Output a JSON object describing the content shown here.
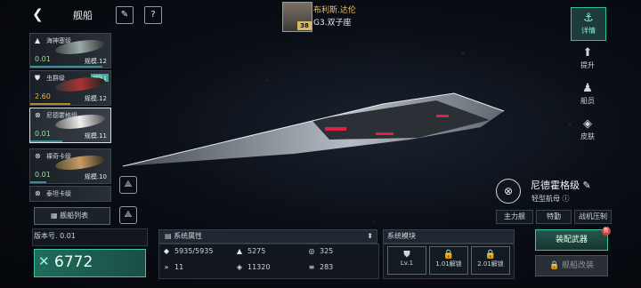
{
  "header": {
    "title": "舰船",
    "commander": {
      "name": "布利斯.达伦",
      "level": "38",
      "star_system": "G3.双子座"
    }
  },
  "ship_list": [
    {
      "name": "海神塞级",
      "value": "0.01",
      "scale": "规模.12",
      "value_color": "green",
      "bar": 0.9,
      "fleet": ""
    },
    {
      "name": "虫群级",
      "value": "2.60",
      "scale": "规模.12",
      "value_color": "orange",
      "bar": 0.5,
      "fleet": "编队1"
    },
    {
      "name": "尼德霍格级",
      "value": "0.01",
      "scale": "规模.11",
      "value_color": "green",
      "bar": 0.4,
      "fleet": "",
      "selected": true
    },
    {
      "name": "裸奇卡级",
      "value": "0.01",
      "scale": "规模.10",
      "value_color": "green",
      "bar": 0.2,
      "fleet": ""
    },
    {
      "name": "泰坦卡级",
      "value": "",
      "scale": "",
      "value_color": "green",
      "bar": 0.0,
      "fleet": ""
    }
  ],
  "list_button": "舰船列表",
  "side_tabs": [
    {
      "label": "详情",
      "icon": "ship-icon",
      "active": true
    },
    {
      "label": "提升",
      "icon": "upgrade-icon",
      "active": false
    },
    {
      "label": "船员",
      "icon": "crew-icon",
      "active": false
    },
    {
      "label": "皮肤",
      "icon": "skin-icon",
      "active": false
    }
  ],
  "ship": {
    "name": "尼德霍格级",
    "type": "轻型航母",
    "tags": [
      "主力舰",
      "特勤",
      "战机压制"
    ]
  },
  "version": "版本号. 0.01",
  "power": "6772",
  "attributes": {
    "header": "系统属性",
    "items": [
      {
        "icon": "hull-icon",
        "value": "5935/5935"
      },
      {
        "icon": "armor-icon",
        "value": "5275"
      },
      {
        "icon": "shield-icon",
        "value": "325"
      },
      {
        "icon": "speed-icon",
        "value": "11"
      },
      {
        "icon": "energy-icon",
        "value": "11320"
      },
      {
        "icon": "weapon-icon",
        "value": "283"
      }
    ]
  },
  "modules": {
    "header": "系统模块",
    "slots": [
      {
        "label": "Lv.1",
        "locked": false
      },
      {
        "label": "1.01解锁",
        "locked": true
      },
      {
        "label": "2.01解锁",
        "locked": true
      }
    ]
  },
  "buttons": {
    "equip": "装配武器",
    "equip_badge": "新",
    "refit": "舰船改装"
  }
}
